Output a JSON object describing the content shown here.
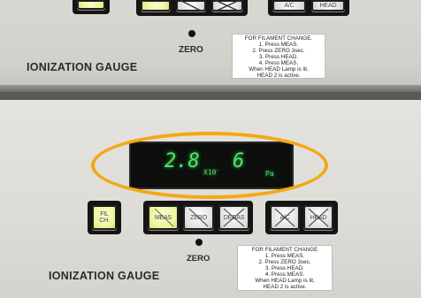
{
  "upper": {
    "buttons": [
      {
        "label": ""
      },
      {
        "label": ""
      },
      {
        "label": ""
      },
      {
        "label": ""
      },
      {
        "label": "A/C"
      },
      {
        "label": "HEAD"
      }
    ],
    "zero_label": "ZERO",
    "gauge_title": "IONIZATION GAUGE",
    "instructions": [
      "FOR FILAMENT CHANGE.",
      "1. Press MEAS.",
      "2. Press ZERO 3sec.",
      "3. Press HEAD.",
      "4. Press MEAS.",
      "When HEAD Lamp is lit,",
      "HEAD 2 is active."
    ]
  },
  "display": {
    "mantissa": "2.8",
    "multiplier": "X10",
    "multiplier_sup": "-",
    "exponent": "6",
    "unit": "Pa",
    "digit_color": "#4fe36a",
    "highlight_color": "#f2a913"
  },
  "lower": {
    "buttons": [
      {
        "label": "FIL CH."
      },
      {
        "label": "MEAS"
      },
      {
        "label": "ZERO"
      },
      {
        "label": "DEGAS"
      },
      {
        "label": "A/C"
      },
      {
        "label": "HEAD"
      }
    ],
    "zero_label": "ZERO",
    "gauge_title": "IONIZATION GAUGE",
    "instructions": [
      "FOR FILAMENT CHANGE",
      "1. Press MEAS.",
      "2. Press ZERO 3sec.",
      "3. Press HEAD.",
      "4. Press MEAS.",
      "When HEAD Lamp is lit,",
      "HEAD 2 is active."
    ]
  }
}
